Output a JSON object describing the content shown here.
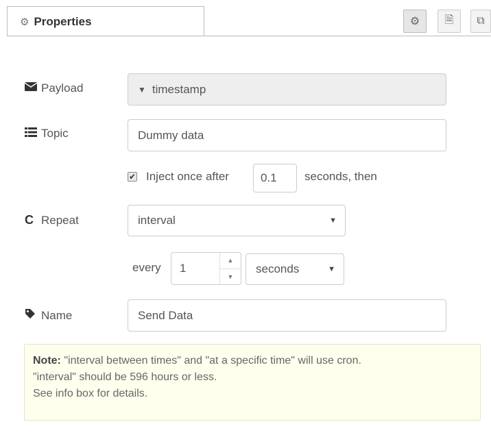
{
  "header": {
    "tab_icon": "gear-icon",
    "tab_label": "Properties",
    "tools": [
      {
        "icon": "gear-icon",
        "glyph": "⚙"
      },
      {
        "icon": "document-icon",
        "glyph": "🗎"
      },
      {
        "icon": "frame-icon",
        "glyph": "⧉"
      }
    ]
  },
  "payload": {
    "label": "Payload",
    "icon": "envelope-icon",
    "value": "timestamp"
  },
  "topic": {
    "label": "Topic",
    "icon": "list-icon",
    "value": "Dummy data"
  },
  "inject": {
    "checked": true,
    "label_before": "Inject once after",
    "value": "0.1",
    "label_after": "seconds, then"
  },
  "repeat": {
    "label": "Repeat",
    "icon": "refresh-icon",
    "value": "interval",
    "every_label": "every",
    "every_value": "1",
    "unit_value": "seconds"
  },
  "name": {
    "label": "Name",
    "icon": "tag-icon",
    "value": "Send Data"
  },
  "note": {
    "bold": "Note:",
    "line1": " \"interval between times\" and \"at a specific time\" will use cron.",
    "line2": "\"interval\" should be 596 hours or less.",
    "line3": "See info box for details."
  },
  "colors": {
    "note_background": "#ffffee",
    "border": "#cccccc",
    "disabled_background": "#eeeeee"
  }
}
